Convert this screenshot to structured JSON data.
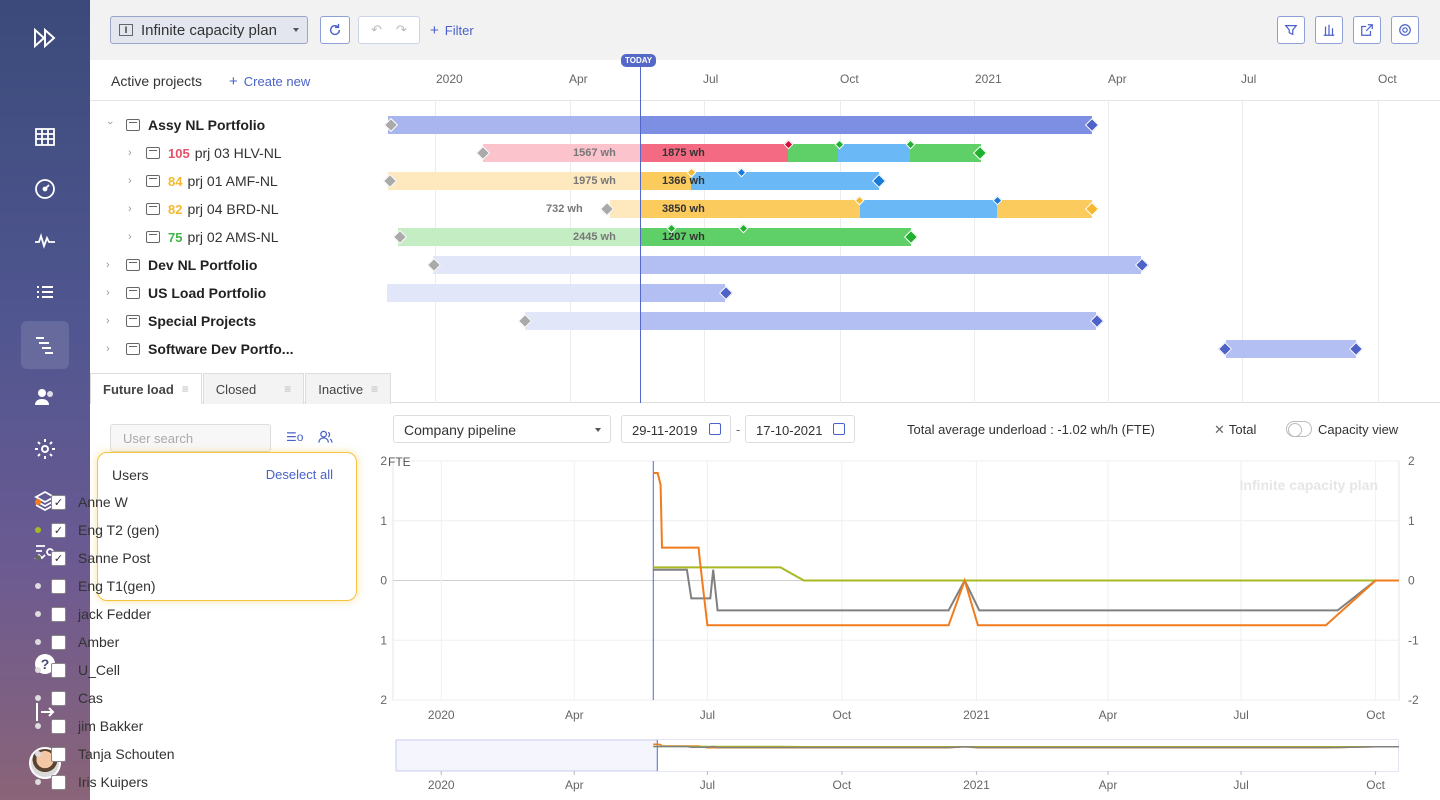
{
  "topbar": {
    "plan_name": "Infinite capacity plan",
    "filter_label": "Filter"
  },
  "gantt": {
    "title": "Active projects",
    "create_new": "Create new",
    "today_label": "TODAY",
    "timeline": [
      "2020",
      "Apr",
      "Jul",
      "Oct",
      "2021",
      "Apr",
      "Jul",
      "Oct"
    ],
    "rows": [
      {
        "name": "Assy NL Portfolio",
        "type": "portfolio",
        "expanded": true
      },
      {
        "score": "105",
        "score_color": "#e8506a",
        "name": "prj 03 HLV-NL",
        "type": "project",
        "past_label": "1567 wh",
        "future_label": "1875 wh"
      },
      {
        "score": "84",
        "score_color": "#f5b830",
        "name": "prj 01 AMF-NL",
        "type": "project",
        "past_label": "1975 wh",
        "future_label": "1366 wh"
      },
      {
        "score": "82",
        "score_color": "#f5b830",
        "name": "prj 04 BRD-NL",
        "type": "project",
        "past_label": "732 wh",
        "future_label": "3850 wh"
      },
      {
        "score": "75",
        "score_color": "#3fb548",
        "name": "prj 02 AMS-NL",
        "type": "project",
        "past_label": "2445 wh",
        "future_label": "1207 wh"
      },
      {
        "name": "Dev NL Portfolio",
        "type": "portfolio"
      },
      {
        "name": "US Load Portfolio",
        "type": "portfolio"
      },
      {
        "name": "Special Projects",
        "type": "portfolio"
      },
      {
        "name": "Software Dev Portfo...",
        "type": "portfolio"
      }
    ]
  },
  "tabs": [
    {
      "label": "Future load",
      "active": true
    },
    {
      "label": "Closed",
      "active": false
    },
    {
      "label": "Inactive",
      "active": false
    }
  ],
  "users_panel": {
    "search_placeholder": "User search",
    "title": "Users",
    "deselect_all": "Deselect all",
    "users": [
      {
        "name": "Anne W",
        "checked": true,
        "color": "#f07c1e"
      },
      {
        "name": "Eng T2 (gen)",
        "checked": true,
        "color": "#a8b820"
      },
      {
        "name": "Sanne Post",
        "checked": true,
        "color": "#666666"
      },
      {
        "name": "Eng T1(gen)",
        "checked": false,
        "color": "#dddddd"
      },
      {
        "name": "jack Fedder",
        "checked": false,
        "color": "#dddddd"
      },
      {
        "name": "Amber",
        "checked": false,
        "color": "#dddddd"
      },
      {
        "name": "U_Cell",
        "checked": false,
        "color": "#dddddd"
      },
      {
        "name": "Cas",
        "checked": false,
        "color": "#dddddd"
      },
      {
        "name": "jim Bakker",
        "checked": false,
        "color": "#dddddd"
      },
      {
        "name": "Tanja Schouten",
        "checked": false,
        "color": "#dddddd"
      },
      {
        "name": "Iris Kuipers",
        "checked": false,
        "color": "#dddddd"
      }
    ]
  },
  "chart_controls": {
    "pipeline": "Company pipeline",
    "date_from": "29-11-2019",
    "date_to": "17-10-2021",
    "avg_text": "Total average underload : -1.02 wh/h (FTE)",
    "total_label": "Total",
    "capacity_view": "Capacity view"
  },
  "chart_data": {
    "type": "line",
    "ylabel": "FTE",
    "watermark": "Infinite capacity plan",
    "ylim": [
      -2,
      2
    ],
    "y_ticks": [
      "2",
      "1",
      "0",
      "-1",
      "-2"
    ],
    "x_ticks": [
      "2020",
      "Apr",
      "Jul",
      "Oct",
      "2021",
      "Apr",
      "Jul",
      "Oct"
    ],
    "today_date": "2020-05-25",
    "x_range": [
      "2019-11-29",
      "2021-10-17"
    ],
    "series": [
      {
        "color": "#f07c1e",
        "points": [
          [
            "2020-05-25",
            1.8
          ],
          [
            "2020-05-28",
            1.8
          ],
          [
            "2020-05-30",
            1.6
          ],
          [
            "2020-05-31",
            0.55
          ],
          [
            "2020-06-25",
            0.55
          ],
          [
            "2020-06-26",
            0.3
          ],
          [
            "2020-07-01",
            -0.75
          ],
          [
            "2020-12-13",
            -0.75
          ],
          [
            "2020-12-24",
            0.0
          ],
          [
            "2021-01-02",
            -0.75
          ],
          [
            "2021-08-28",
            -0.75
          ],
          [
            "2021-10-01",
            0.0
          ],
          [
            "2021-10-17",
            0.0
          ]
        ]
      },
      {
        "color": "#a8b820",
        "points": [
          [
            "2020-05-25",
            0.22
          ],
          [
            "2020-08-20",
            0.22
          ],
          [
            "2020-09-05",
            0.0
          ],
          [
            "2021-10-17",
            0.0
          ]
        ]
      },
      {
        "color": "#808080",
        "points": [
          [
            "2020-05-25",
            0.18
          ],
          [
            "2020-06-17",
            0.18
          ],
          [
            "2020-06-20",
            -0.3
          ],
          [
            "2020-07-03",
            -0.3
          ],
          [
            "2020-07-05",
            0.18
          ],
          [
            "2020-07-08",
            -0.5
          ],
          [
            "2020-12-13",
            -0.5
          ],
          [
            "2020-12-24",
            0.0
          ],
          [
            "2021-01-03",
            -0.5
          ],
          [
            "2021-09-05",
            -0.5
          ],
          [
            "2021-10-01",
            0.0
          ],
          [
            "2021-10-17",
            0.0
          ]
        ]
      }
    ]
  }
}
